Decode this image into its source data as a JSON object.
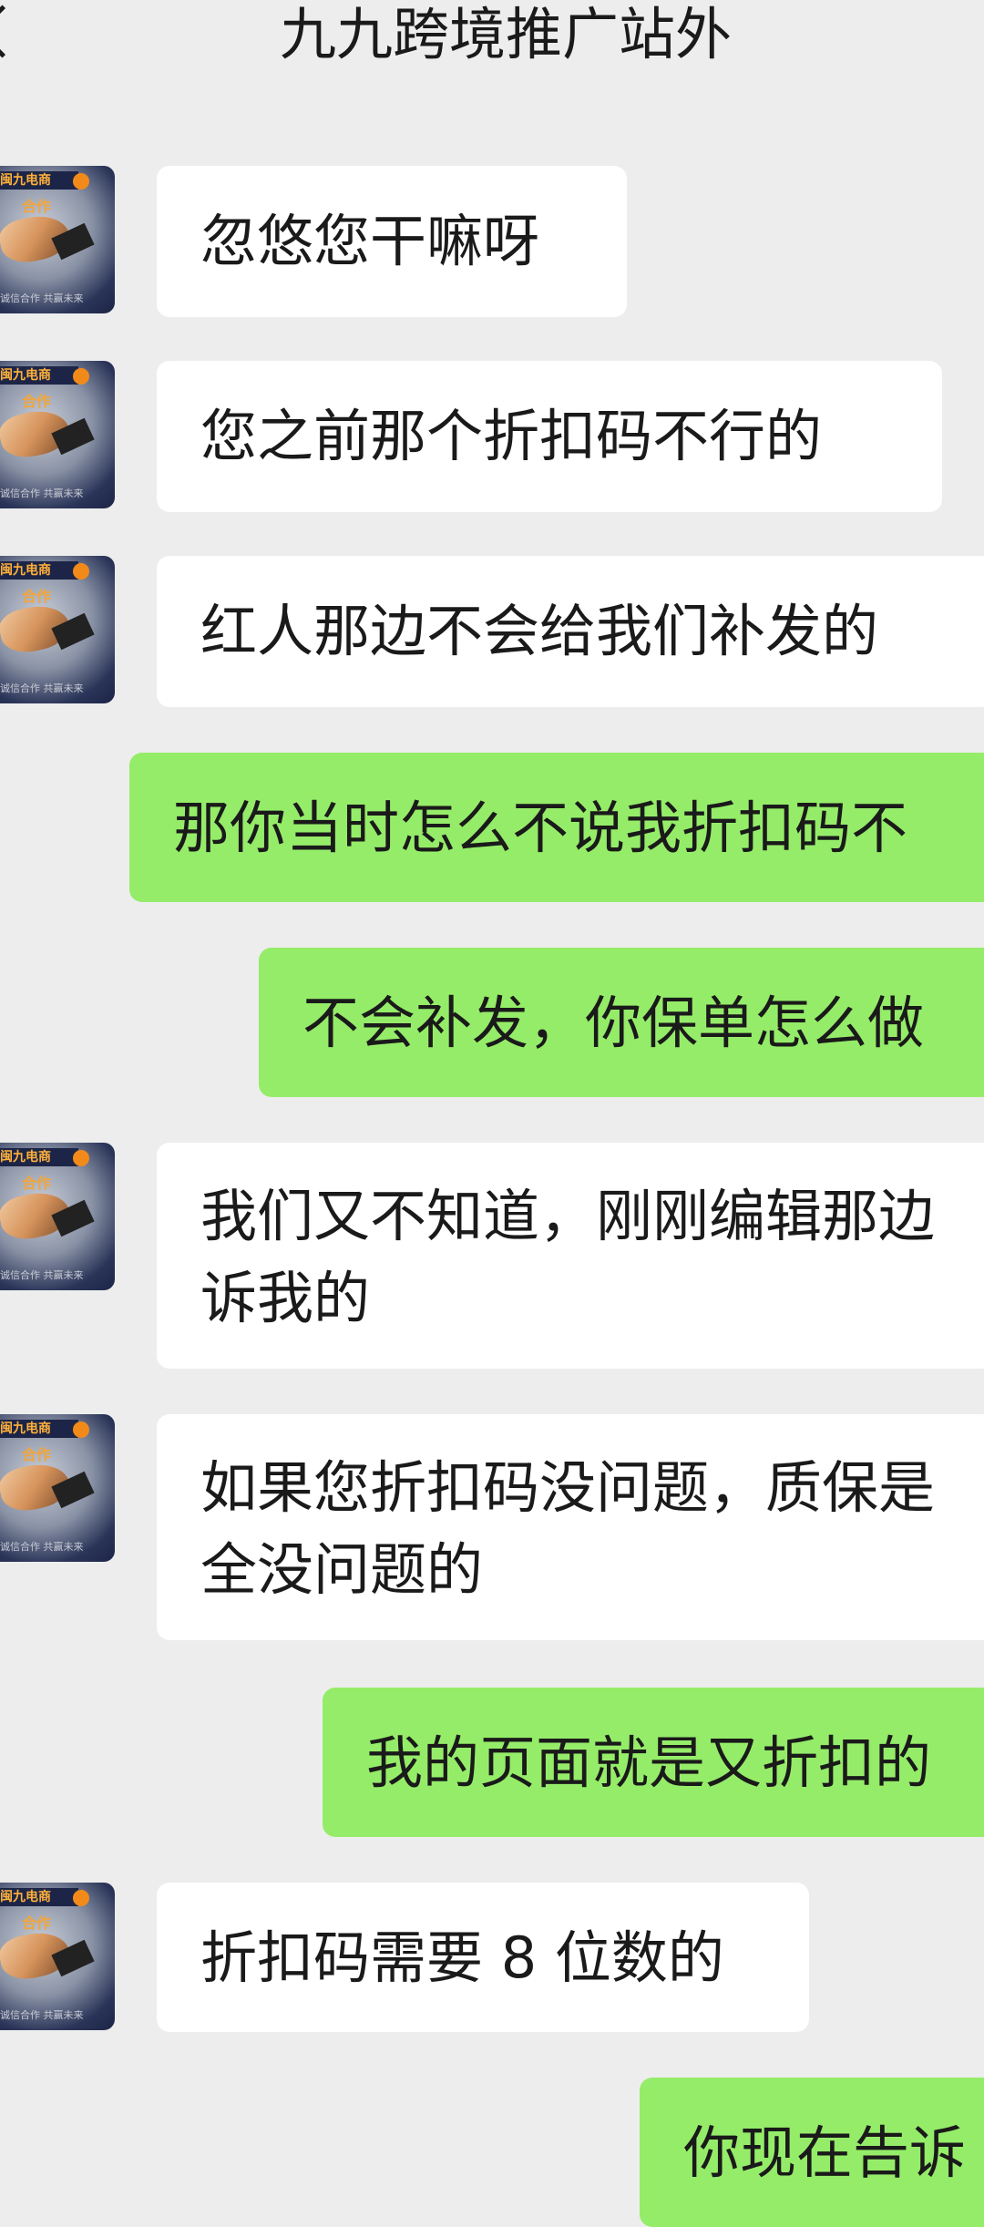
{
  "header": {
    "title": "九九跨境推广站外"
  },
  "messages": [
    {
      "side": "left",
      "lines": [
        "忽悠您干嘛呀"
      ]
    },
    {
      "side": "left",
      "lines": [
        "您之前那个折扣码不行的"
      ]
    },
    {
      "side": "left",
      "lines": [
        "红人那边不会给我们补发的"
      ]
    },
    {
      "side": "right",
      "lines": [
        "那你当时怎么不说我折扣码不"
      ]
    },
    {
      "side": "right",
      "lines": [
        "不会补发，你保单怎么做"
      ]
    },
    {
      "side": "left",
      "lines": [
        "我们又不知道，刚刚编辑那边",
        "诉我的"
      ]
    },
    {
      "side": "left",
      "lines": [
        "如果您折扣码没问题，质保是",
        "全没问题的"
      ]
    },
    {
      "side": "right",
      "lines": [
        "我的页面就是又折扣的"
      ]
    },
    {
      "side": "left",
      "lines": [
        "折扣码需要 8 位数的"
      ]
    },
    {
      "side": "right",
      "lines": [
        "你现在告诉"
      ]
    }
  ],
  "avatar": {
    "brand_text": "闽九电商",
    "center_text": "合作",
    "bottom_text": "诚信合作 共赢未来"
  }
}
